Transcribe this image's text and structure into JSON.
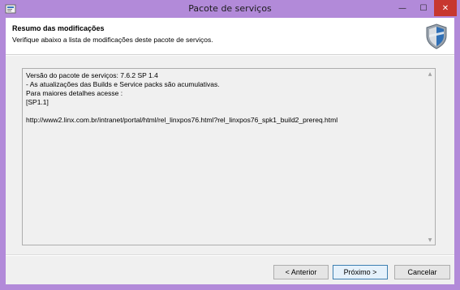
{
  "window": {
    "title": "Pacote de serviços",
    "minimize_glyph": "—",
    "maximize_glyph": "☐",
    "close_glyph": "✕",
    "frame_color": "#b28ad9",
    "close_color": "#c7372f"
  },
  "header": {
    "title": "Resumo das modificações",
    "subtitle": "Verifique abaixo a lista de modificações deste pacote de serviços.",
    "icon": "shield-icon"
  },
  "details": {
    "text": "Versão do pacote de serviços: 7.6.2 SP 1.4\n- As atualizações das Builds e Service packs são acumulativas.\nPara maiores detalhes acesse :\n[SP1.1]\n\nhttp://www2.linx.com.br/intranet/portal/html/rel_linxpos76.html?rel_linxpos76_spk1_build2_prereq.html",
    "scroll_up_glyph": "▲",
    "scroll_down_glyph": "▼"
  },
  "buttons": {
    "back": "< Anterior",
    "next": "Próximo >",
    "cancel": "Cancelar"
  }
}
